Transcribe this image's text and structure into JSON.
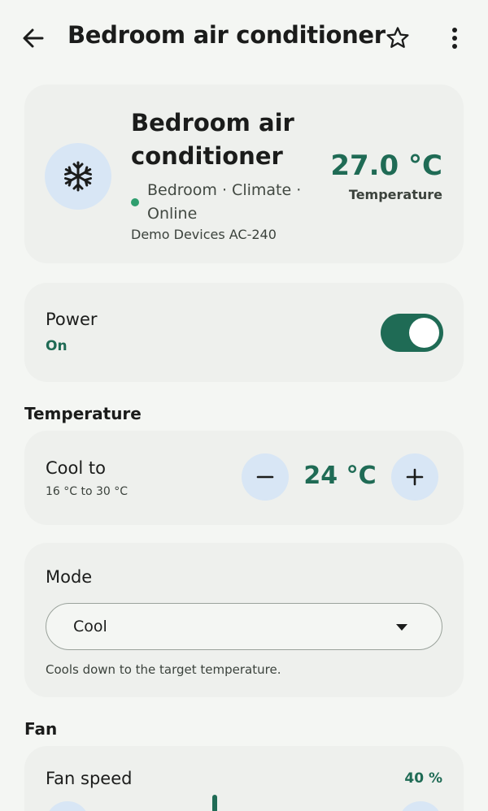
{
  "header": {
    "title": "Bedroom air conditioner",
    "back_icon": "arrow-back-icon",
    "favorite_icon": "star-outline-icon",
    "more_icon": "more-vert-icon"
  },
  "device": {
    "name": "Bedroom air conditioner",
    "icon": "snowflake-icon",
    "meta": "Bedroom · Climate · Online",
    "model": "Demo Devices AC-240",
    "current_temperature": "27.0 °C",
    "current_temperature_label": "Temperature",
    "status_color": "#2e9e6e"
  },
  "power": {
    "label": "Power",
    "state": "On",
    "enabled": true
  },
  "temperature_section": {
    "title": "Temperature",
    "label": "Cool to",
    "range": "16 °C to 30 °C",
    "target": "24 °C",
    "decrease_icon": "minus-icon",
    "increase_icon": "plus-icon"
  },
  "mode": {
    "label": "Mode",
    "selected": "Cool",
    "description": "Cools down to the target temperature.",
    "caret_icon": "dropdown-caret-icon"
  },
  "fan_section": {
    "title": "Fan",
    "label": "Fan speed",
    "value": "40 %",
    "level_fraction": 0.4
  },
  "colors": {
    "accent": "#1f6b55",
    "card": "#eef0ed",
    "background": "#f4f6f3",
    "button_tint": "#d8e6f5"
  }
}
